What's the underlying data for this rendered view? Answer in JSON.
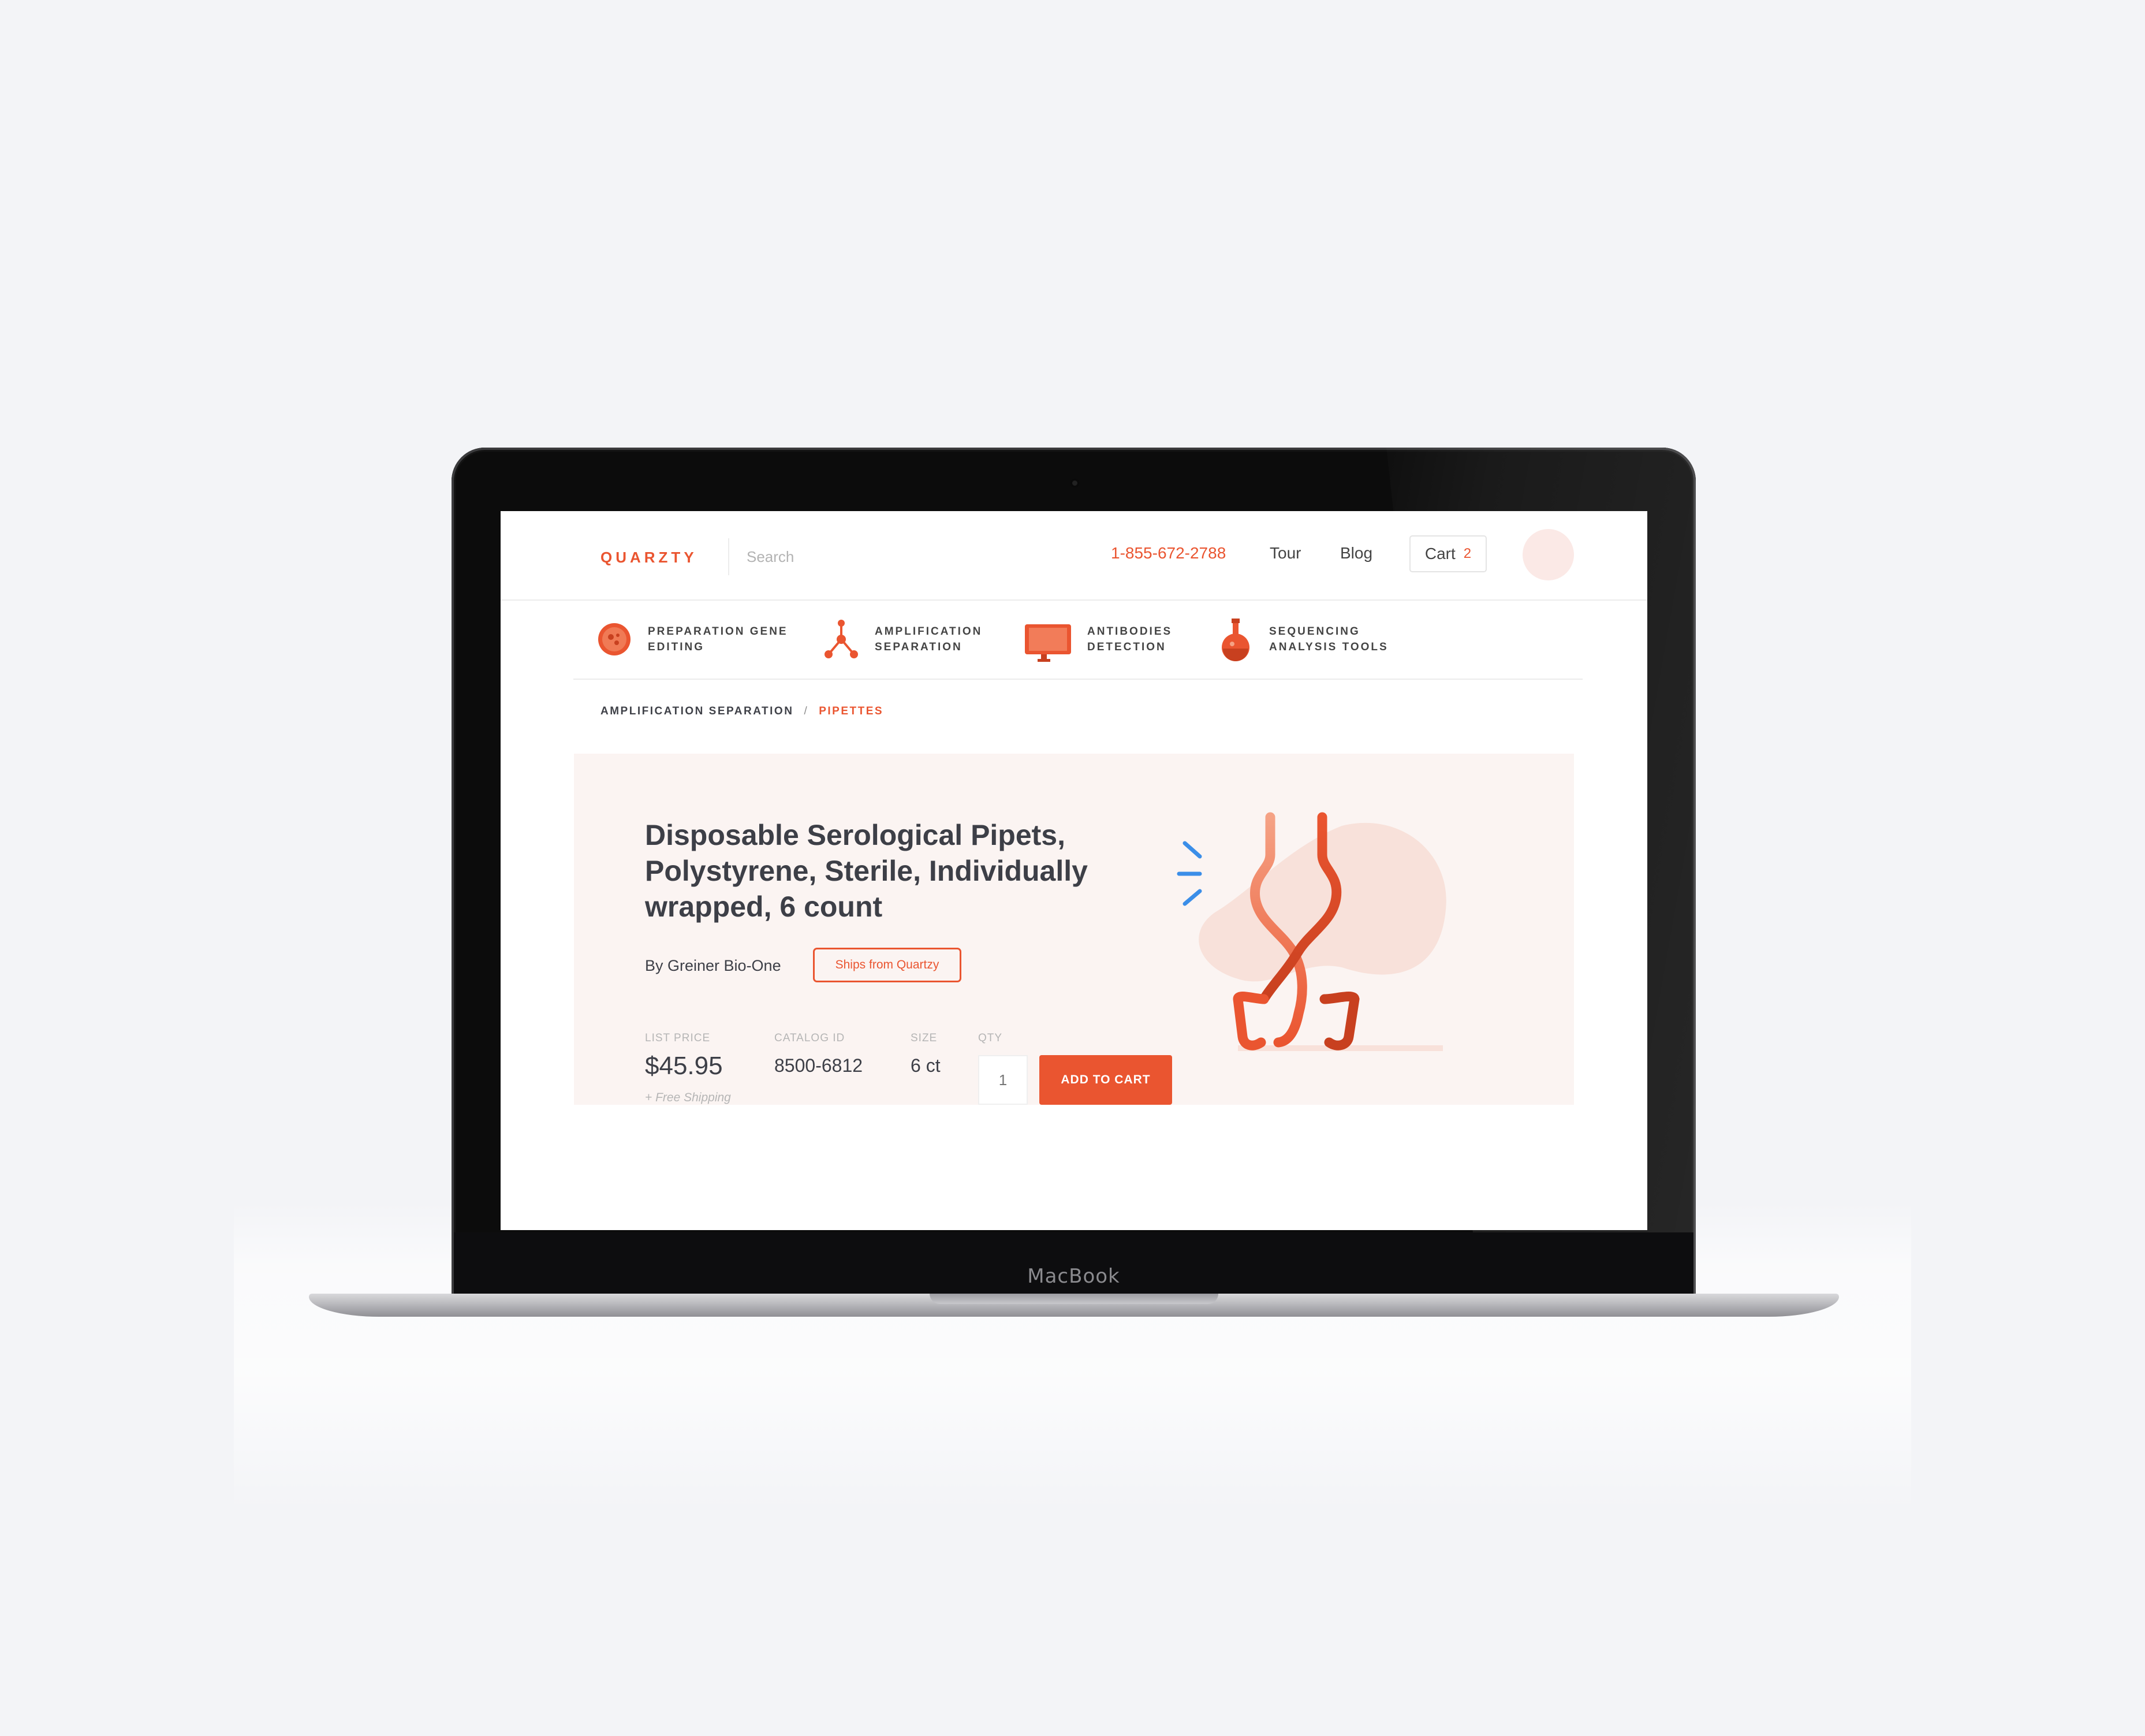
{
  "device": {
    "label": "MacBook"
  },
  "header": {
    "logo": "QUARZTY",
    "search_placeholder": "Search",
    "phone": "1-855-672-2788",
    "nav": [
      "Tour",
      "Blog"
    ],
    "cart_label": "Cart",
    "cart_count": "2"
  },
  "categories": [
    {
      "label": "PREPARATION GENE EDITING",
      "icon": "cell-icon"
    },
    {
      "label": "AMPLIFICATION SEPARATION",
      "icon": "molecule-icon"
    },
    {
      "label": "ANTIBODIES DETECTION",
      "icon": "monitor-icon"
    },
    {
      "label": "SEQUENCING ANALYSIS TOOLS",
      "icon": "flask-icon"
    }
  ],
  "breadcrumb": {
    "parent": "AMPLIFICATION SEPARATION",
    "separator": "/",
    "current": "PIPETTES"
  },
  "product": {
    "title": "Disposable Serological Pipets, Polystyrene, Sterile, Individually wrapped, 6 count",
    "brand": "By Greiner Bio-One",
    "ships_badge": "Ships from Quartzy",
    "list_price_label": "LIST PRICE",
    "list_price": "$45.95",
    "shipping_note": "+ Free Shipping",
    "catalog_label": "CATALOG ID",
    "catalog_id": "8500-6812",
    "size_label": "SIZE",
    "size": "6 ct",
    "qty_label": "QTY",
    "qty_placeholder": "1",
    "add_to_cart": "ADD TO CART",
    "illustration_icon": "pipette-illustration"
  },
  "colors": {
    "accent": "#ea5530",
    "hero_bg": "#fbf4f2",
    "text": "#3d3f47",
    "muted": "#b5b5b5",
    "spark": "#3b8ee8"
  }
}
